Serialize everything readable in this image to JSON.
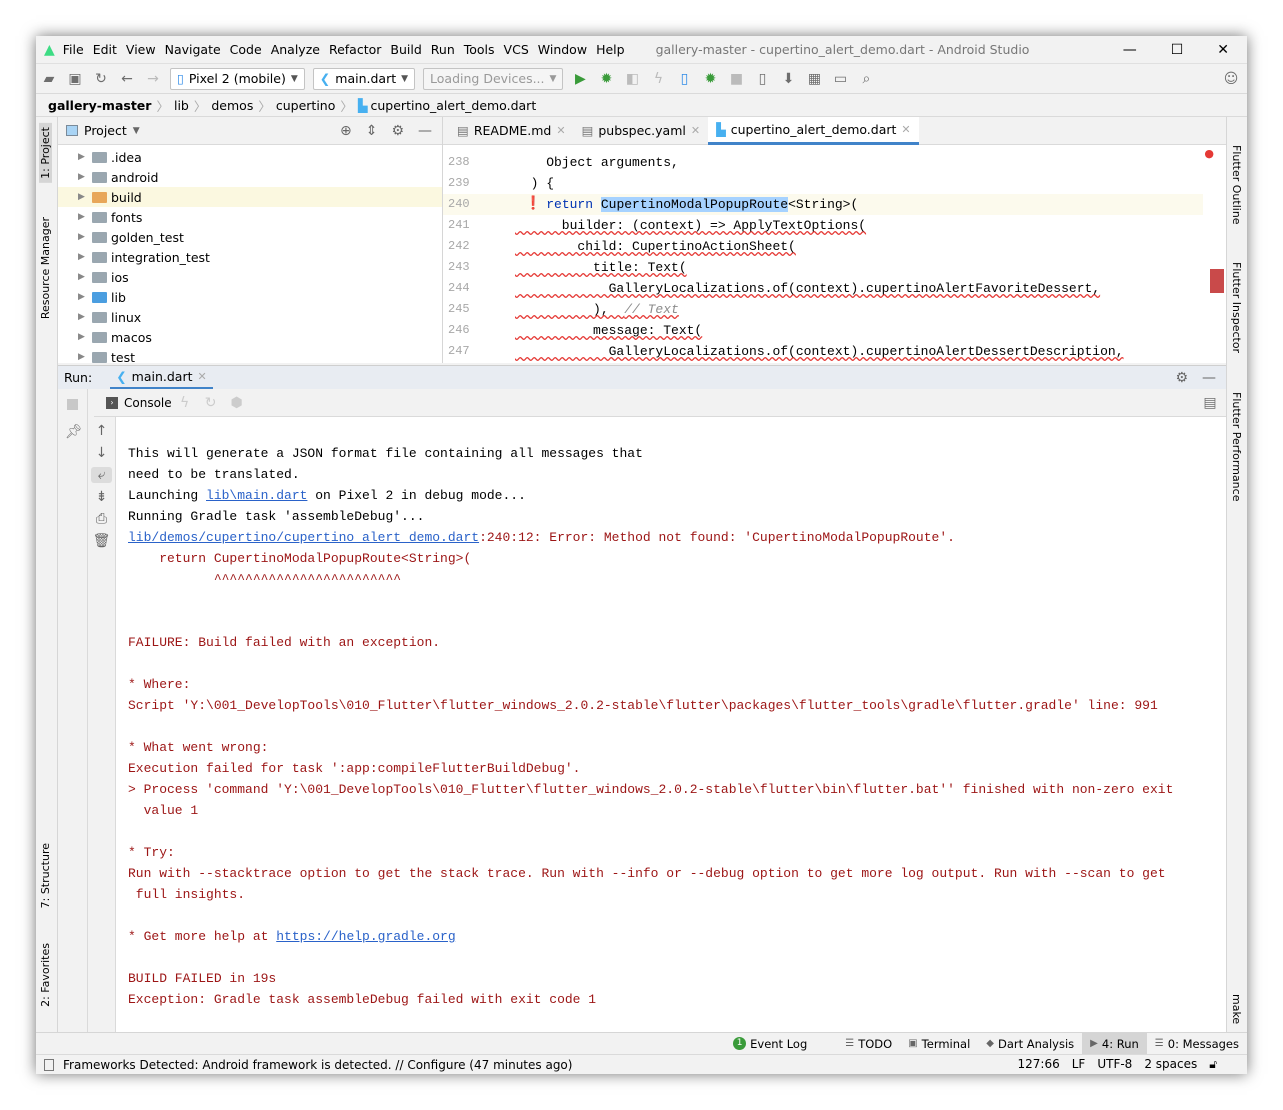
{
  "window": {
    "title": "gallery-master - cupertino_alert_demo.dart - Android Studio"
  },
  "menu": [
    "File",
    "Edit",
    "View",
    "Navigate",
    "Code",
    "Analyze",
    "Refactor",
    "Build",
    "Run",
    "Tools",
    "VCS",
    "Window",
    "Help"
  ],
  "toolbar": {
    "device": "Pixel 2 (mobile)",
    "run_config": "main.dart",
    "devices_loading": "Loading Devices..."
  },
  "breadcrumb": [
    "gallery-master",
    "lib",
    "demos",
    "cupertino",
    "cupertino_alert_demo.dart"
  ],
  "left_strip": {
    "project": "1: Project",
    "resource_manager": "Resource Manager",
    "structure": "7: Structure",
    "favorites": "2: Favorites"
  },
  "right_strip": {
    "outline": "Flutter Outline",
    "inspector": "Flutter Inspector",
    "performance": "Flutter Performance",
    "make": "make"
  },
  "project": {
    "title": "Project",
    "items": [
      {
        "name": ".idea",
        "color": "#9aa7b0"
      },
      {
        "name": "android",
        "color": "#9aa7b0"
      },
      {
        "name": "build",
        "color": "#e8a75a",
        "selected": true
      },
      {
        "name": "fonts",
        "color": "#9aa7b0"
      },
      {
        "name": "golden_test",
        "color": "#9aa7b0"
      },
      {
        "name": "integration_test",
        "color": "#9aa7b0"
      },
      {
        "name": "ios",
        "color": "#9aa7b0"
      },
      {
        "name": "lib",
        "color": "#4b9ee0"
      },
      {
        "name": "linux",
        "color": "#9aa7b0"
      },
      {
        "name": "macos",
        "color": "#9aa7b0"
      },
      {
        "name": "test",
        "color": "#9aa7b0"
      }
    ]
  },
  "editor": {
    "tabs": [
      {
        "label": "README.md"
      },
      {
        "label": "pubspec.yaml"
      },
      {
        "label": "cupertino_alert_demo.dart",
        "active": true
      }
    ],
    "lines": [
      {
        "num": "238",
        "seg": [
          {
            "t": "    Object arguments,"
          }
        ]
      },
      {
        "num": "239",
        "seg": [
          {
            "t": "  ) {"
          }
        ]
      },
      {
        "num": "240",
        "error": true,
        "seg": [
          {
            "t": "    "
          },
          {
            "t": "return",
            "k": "kw"
          },
          {
            "t": " "
          },
          {
            "t": "CupertinoModalPopupRoute",
            "k": "hl"
          },
          {
            "t": "<String>("
          }
        ]
      },
      {
        "num": "241",
        "wavy": true,
        "seg": [
          {
            "t": "      builder: (context) => ApplyTextOptions("
          }
        ]
      },
      {
        "num": "242",
        "wavy": true,
        "seg": [
          {
            "t": "        child: CupertinoActionSheet("
          }
        ]
      },
      {
        "num": "243",
        "wavy": true,
        "seg": [
          {
            "t": "          title: Text("
          }
        ]
      },
      {
        "num": "244",
        "wavy": true,
        "seg": [
          {
            "t": "            GalleryLocalizations.of(context).cupertinoAlertFavoriteDessert,"
          }
        ]
      },
      {
        "num": "245",
        "wavy": true,
        "seg": [
          {
            "t": "          ),  "
          },
          {
            "t": "// Text",
            "k": "cm"
          }
        ]
      },
      {
        "num": "246",
        "wavy": true,
        "seg": [
          {
            "t": "          message: Text("
          }
        ]
      },
      {
        "num": "247",
        "wavy": true,
        "seg": [
          {
            "t": "            GalleryLocalizations.of(context).cupertinoAlertDessertDescription,"
          }
        ]
      }
    ]
  },
  "run": {
    "label": "Run:",
    "tab": "main.dart",
    "console_label": "Console"
  },
  "console": [
    [
      {
        "t": "This will generate a JSON format file containing all messages that",
        "k": "n"
      }
    ],
    [
      {
        "t": "need to be translated.",
        "k": "n"
      }
    ],
    [
      {
        "t": "Launching ",
        "k": "n"
      },
      {
        "t": "lib\\main.dart",
        "k": "l"
      },
      {
        "t": " on Pixel 2 in debug mode...",
        "k": "n"
      }
    ],
    [
      {
        "t": "Running Gradle task 'assembleDebug'...",
        "k": "n"
      }
    ],
    [
      {
        "t": "lib/demos/cupertino/cupertino_alert_demo.dart",
        "k": "l"
      },
      {
        "t": ":240:12: Error: Method not found: 'CupertinoModalPopupRoute'.",
        "k": "e"
      }
    ],
    [
      {
        "t": "    return CupertinoModalPopupRoute<String>(",
        "k": "e"
      }
    ],
    [
      {
        "t": "           ^^^^^^^^^^^^^^^^^^^^^^^^",
        "k": "e"
      }
    ],
    [],
    [],
    [
      {
        "t": "FAILURE: Build failed with an exception.",
        "k": "e"
      }
    ],
    [],
    [
      {
        "t": "* Where:",
        "k": "e"
      }
    ],
    [
      {
        "t": "Script 'Y:\\001_DevelopTools\\010_Flutter\\flutter_windows_2.0.2-stable\\flutter\\packages\\flutter_tools\\gradle\\flutter.gradle' line: 991",
        "k": "e"
      }
    ],
    [],
    [
      {
        "t": "* What went wrong:",
        "k": "e"
      }
    ],
    [
      {
        "t": "Execution failed for task ':app:compileFlutterBuildDebug'.",
        "k": "e"
      }
    ],
    [
      {
        "t": "> Process 'command 'Y:\\001_DevelopTools\\010_Flutter\\flutter_windows_2.0.2-stable\\flutter\\bin\\flutter.bat'' finished with non-zero exit",
        "k": "e"
      }
    ],
    [
      {
        "t": "  value 1",
        "k": "e"
      }
    ],
    [],
    [
      {
        "t": "* Try:",
        "k": "e"
      }
    ],
    [
      {
        "t": "Run with --stacktrace option to get the stack trace. Run with --info or --debug option to get more log output. Run with --scan to get",
        "k": "e"
      }
    ],
    [
      {
        "t": " full insights.",
        "k": "e"
      }
    ],
    [],
    [
      {
        "t": "* Get more help at ",
        "k": "e"
      },
      {
        "t": "https://help.gradle.org",
        "k": "l"
      }
    ],
    [],
    [
      {
        "t": "BUILD FAILED in 19s",
        "k": "e"
      }
    ],
    [
      {
        "t": "Exception: Gradle task assembleDebug failed with exit code 1",
        "k": "e"
      }
    ]
  ],
  "bottom_tabs": [
    {
      "label": "TODO"
    },
    {
      "label": "Terminal"
    },
    {
      "label": "Dart Analysis"
    },
    {
      "label": "4: Run",
      "active": true
    },
    {
      "label": "0: Messages"
    }
  ],
  "event_log": {
    "label": "Event Log",
    "count": "1"
  },
  "status": {
    "message": "Frameworks Detected: Android framework is detected. // Configure (47 minutes ago)",
    "position": "127:66",
    "line_sep": "LF",
    "encoding": "UTF-8",
    "indent": "2 spaces"
  },
  "colors": {
    "accent": "#4083c9",
    "error": "#9c1515",
    "link": "#2a62c9",
    "run_green": "#3a9b3a"
  }
}
